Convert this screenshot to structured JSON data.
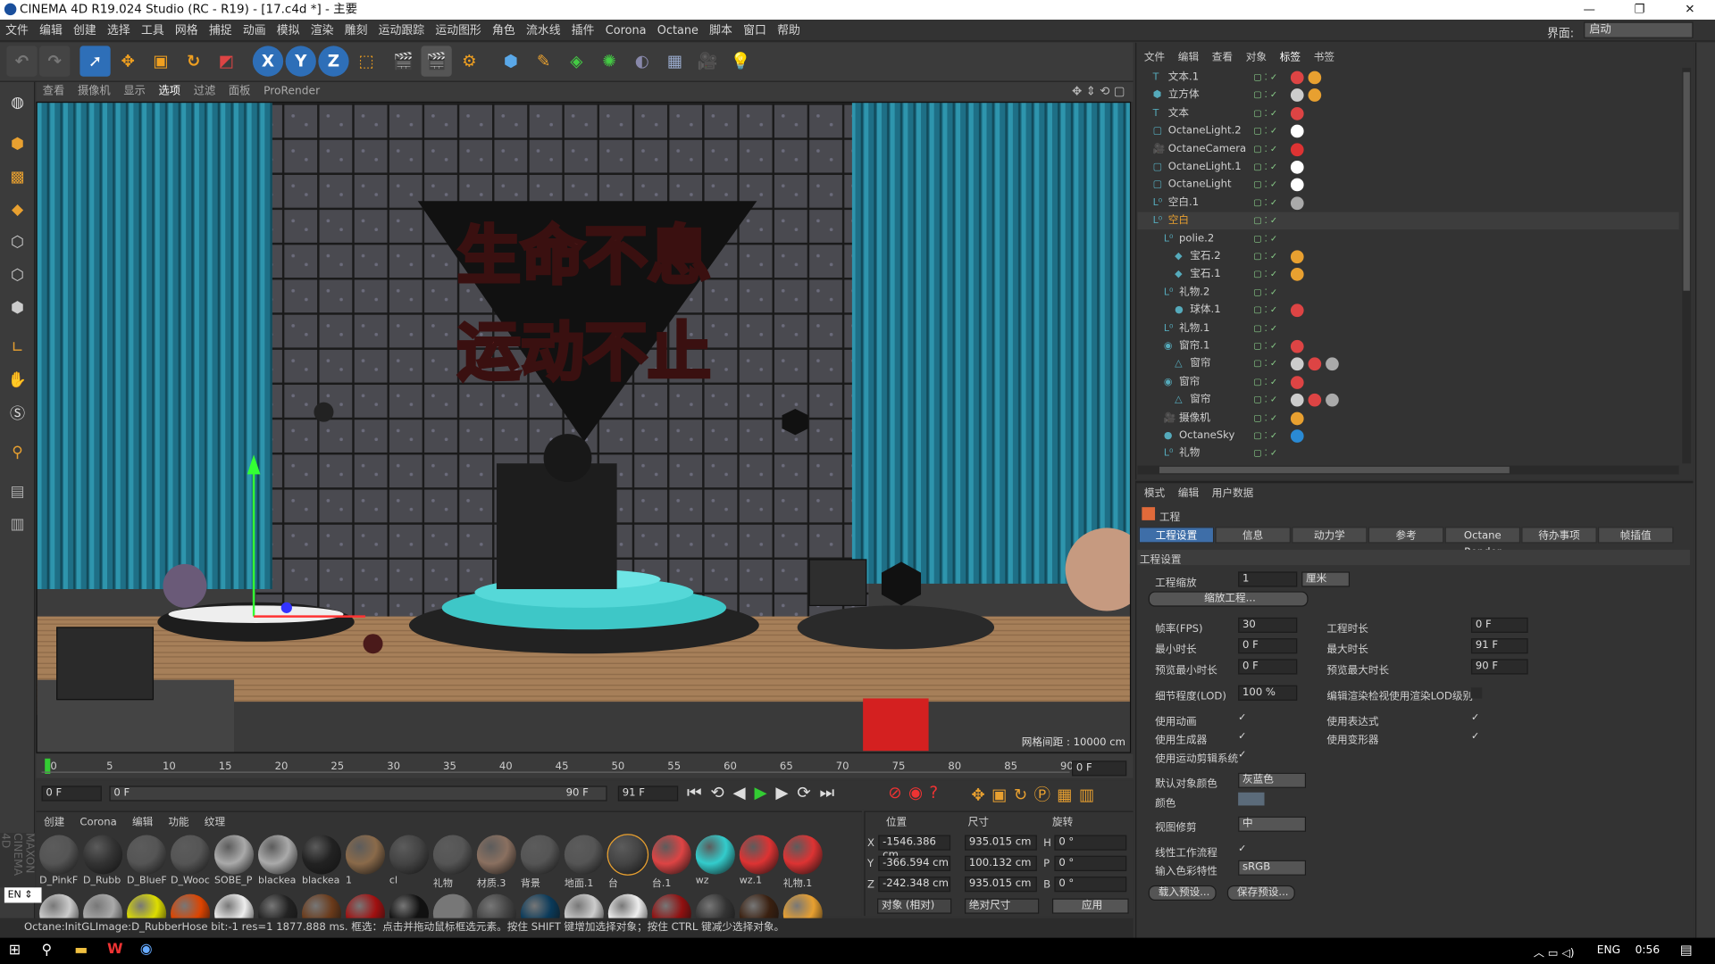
{
  "window": {
    "title": "CINEMA 4D R19.024 Studio (RC - R19) - [17.c4d *] - 主要",
    "min": "—",
    "max": "❐",
    "close": "✕"
  },
  "menu": [
    "文件",
    "编辑",
    "创建",
    "选择",
    "工具",
    "网格",
    "捕捉",
    "动画",
    "模拟",
    "渲染",
    "雕刻",
    "运动跟踪",
    "运动图形",
    "角色",
    "流水线",
    "插件",
    "Corona",
    "Octane",
    "脚本",
    "窗口",
    "帮助"
  ],
  "layout": {
    "label": "界面:",
    "value": "启动"
  },
  "viewport": {
    "menu": [
      "查看",
      "摄像机",
      "显示",
      "选项",
      "过滤",
      "面板",
      "ProRender"
    ],
    "grid": "网格间距 : 10000 cm",
    "text1": "生命不息",
    "text2": "运动不止"
  },
  "timeline": {
    "ticks": [
      "0",
      "5",
      "10",
      "15",
      "20",
      "25",
      "30",
      "35",
      "40",
      "45",
      "50",
      "55",
      "60",
      "65",
      "70",
      "75",
      "80",
      "85",
      "90"
    ],
    "end": "0 F"
  },
  "transport": {
    "start": "0 F",
    "range_start": "0 F",
    "range_end": "90 F",
    "end": "91 F"
  },
  "materials": {
    "menu": [
      "创建",
      "Corona",
      "编辑",
      "功能",
      "纹理"
    ],
    "names": [
      "D_PinkF",
      "D_Rubb",
      "D_BlueF",
      "D_Wooc",
      "SOBE_P",
      "blackea",
      "blackea",
      "1",
      "cl",
      "礼物",
      "材质.3",
      "背景",
      "地面.1",
      "台",
      "台.1",
      "wz",
      "wz.1",
      "礼物.1"
    ]
  },
  "coords": {
    "headers": [
      "位置",
      "尺寸",
      "旋转"
    ],
    "rows": [
      {
        "axis": "X",
        "pos": "-1546.386 cm",
        "size": "935.015 cm",
        "rlab": "H",
        "rot": "0 °"
      },
      {
        "axis": "Y",
        "pos": "-366.594 cm",
        "size": "100.132 cm",
        "rlab": "P",
        "rot": "0 °"
      },
      {
        "axis": "Z",
        "pos": "-242.348 cm",
        "size": "935.015 cm",
        "rlab": "B",
        "rot": "0 °"
      }
    ],
    "mode": "对象 (相对)",
    "sizemode": "绝对尺寸",
    "apply": "应用"
  },
  "status": "Octane:InitGLImage:D_RubberHose  bit:-1 res=1  1877.888 ms.    框选：点击并拖动鼠标框选元素。按住 SHIFT 键增加选择对象；按住 CTRL 键减少选择对象。",
  "objects": {
    "menu": [
      "文件",
      "编辑",
      "查看",
      "对象",
      "标签",
      "书签"
    ],
    "rows": [
      "文本.1",
      "立方体",
      "文本",
      "OctaneLight.2",
      "OctaneCamera",
      "OctaneLight.1",
      "OctaneLight",
      "空白.1",
      "空白",
      "polie.2",
      "宝石.2",
      "宝石.1",
      "礼物.2",
      "球体.1",
      "礼物.1",
      "窗帘.1",
      "窗帘",
      "窗帘",
      "窗帘",
      "摄像机",
      "OctaneSky",
      "礼物"
    ]
  },
  "attributes": {
    "menu": [
      "模式",
      "编辑",
      "用户数据"
    ],
    "title": "工程",
    "tabs": [
      "工程设置",
      "信息",
      "动力学",
      "参考",
      "Octane Render",
      "待办事项",
      "帧插值"
    ],
    "section": "工程设置",
    "scale_label": "工程缩放",
    "scale_value": "1",
    "scale_unit": "厘米",
    "scale_btn": "缩放工程...",
    "fps_label": "帧率(FPS)",
    "fps": "30",
    "dur_label": "工程时长",
    "dur": "0 F",
    "min_label": "最小时长",
    "min": "0 F",
    "max_label": "最大时长",
    "max": "91 F",
    "pmin_label": "预览最小时长",
    "pmin": "0 F",
    "pmax_label": "预览最大时长",
    "pmax": "90 F",
    "lod_label": "细节程度(LOD)",
    "lod": "100 %",
    "lodrender": "编辑渲染检视使用渲染LOD级别",
    "anim": "使用动画",
    "expr": "使用表达式",
    "gen": "使用生成器",
    "deform": "使用变形器",
    "motion": "使用运动剪辑系统",
    "color_label": "默认对象颜色",
    "color": "灰蓝色",
    "color2": "颜色",
    "clip_label": "视图修剪",
    "clip": "中",
    "linear": "线性工作流程",
    "input_label": "输入色彩特性",
    "input": "sRGB",
    "load": "载入预设...",
    "save": "保存预设..."
  },
  "taskbar": {
    "lang": "ENG",
    "time": "0:56"
  }
}
